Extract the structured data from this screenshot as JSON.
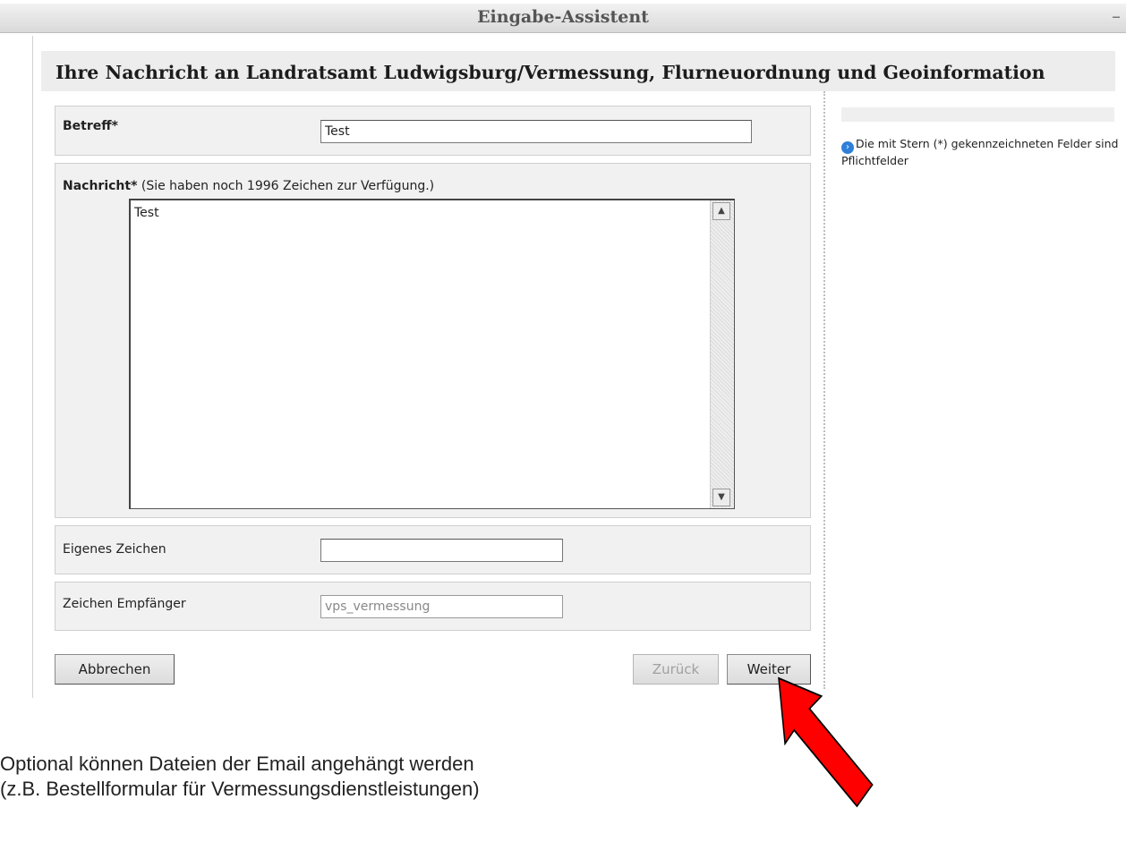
{
  "window": {
    "title": "Eingabe-Assistent",
    "minimize_glyph": "–"
  },
  "form": {
    "heading": "Ihre Nachricht an Landratsamt Ludwigsburg/Vermessung, Flurneuordnung und Geoinformation",
    "subject": {
      "label": "Betreff*",
      "value": "Test"
    },
    "message": {
      "label": "Nachricht*",
      "char_hint": "(Sie haben noch 1996 Zeichen zur Verfügung.)",
      "value": "Test"
    },
    "own_reference": {
      "label": "Eigenes Zeichen",
      "value": ""
    },
    "recipient_reference": {
      "label": "Zeichen Empfänger",
      "value": "vps_vermessung"
    }
  },
  "sidebar": {
    "hint": "Die mit Stern (*) gekennzeichneten Felder sind Pflichtfelder",
    "icon": "info-icon"
  },
  "buttons": {
    "cancel": "Abbrechen",
    "back": "Zurück",
    "next": "Weiter"
  },
  "caption": {
    "line1": "Optional können Dateien der Email angehängt werden",
    "line2": "(z.B. Bestellformular für Vermessungsdienstleistungen)"
  },
  "colors": {
    "arrow": "#ff0000"
  }
}
